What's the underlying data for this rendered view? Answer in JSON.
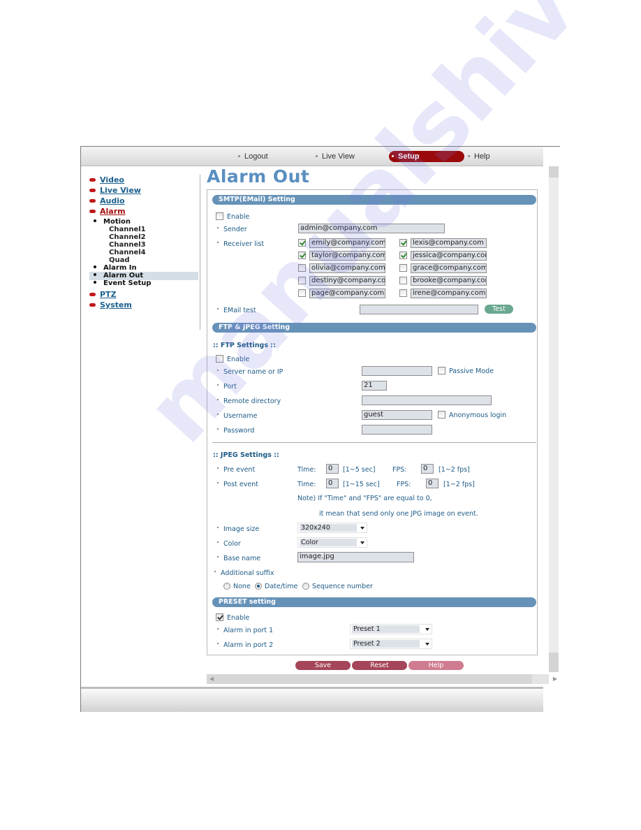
{
  "topnav": {
    "items": [
      {
        "label": "Logout",
        "active": false
      },
      {
        "label": "Live View",
        "active": false
      },
      {
        "label": "Setup",
        "active": true
      },
      {
        "label": "Help",
        "active": false
      }
    ]
  },
  "sidebar": {
    "top_items": [
      {
        "label": "Video",
        "active": false
      },
      {
        "label": "Live View",
        "active": false
      },
      {
        "label": "Audio",
        "active": false
      },
      {
        "label": "Alarm",
        "active": true
      },
      {
        "label": "PTZ",
        "active": false
      },
      {
        "label": "System",
        "active": false
      }
    ],
    "alarm_sub": [
      {
        "label": "Motion",
        "active": false
      },
      {
        "label": "Alarm In",
        "active": false
      },
      {
        "label": "Alarm Out",
        "active": true
      },
      {
        "label": "Event Setup",
        "active": false
      }
    ],
    "motion_sub": [
      "Channel1",
      "Channel2",
      "Channel3",
      "Channel4",
      "Quad"
    ]
  },
  "page": {
    "title": "Alarm Out"
  },
  "smtp": {
    "header": "SMTP(EMail) Setting",
    "enable_label": "Enable",
    "enable_checked": false,
    "sender_label": "Sender",
    "sender_value": "admin@company.com",
    "receiver_label": "Receiver list",
    "receivers": [
      {
        "email": "emily@company.com",
        "checked": true
      },
      {
        "email": "lexis@company.com",
        "checked": true
      },
      {
        "email": "taylor@company.com",
        "checked": true
      },
      {
        "email": "jessica@company.com",
        "checked": true
      },
      {
        "email": "olivia@company.com",
        "checked": false
      },
      {
        "email": "grace@company.com",
        "checked": false
      },
      {
        "email": "destiny@company.com",
        "checked": false
      },
      {
        "email": "brooke@company.com",
        "checked": false
      },
      {
        "email": "page@company.com",
        "checked": false
      },
      {
        "email": "irene@company.com",
        "checked": false
      }
    ],
    "email_test_label": "EMail test",
    "email_test_value": "",
    "test_button": "Test"
  },
  "ftp_jpeg": {
    "header": "FTP & JPEG Setting",
    "ftp_subheader": ":: FTP Settings ::",
    "enable_label": "Enable",
    "enable_checked": false,
    "server_label": "Server name or IP",
    "server_value": "",
    "passive_label": "Passive Mode",
    "passive_checked": false,
    "port_label": "Port",
    "port_value": "21",
    "remote_dir_label": "Remote directory",
    "remote_dir_value": "",
    "username_label": "Username",
    "username_value": "guest",
    "anonymous_label": "Anonymous login",
    "anonymous_checked": false,
    "password_label": "Password",
    "password_value": "",
    "jpeg_subheader": ":: JPEG Settings ::",
    "pre_event_label": "Pre event",
    "post_event_label": "Post event",
    "time_label": "Time:",
    "fps_label": "FPS:",
    "pre_time_value": "0",
    "pre_time_range": "[1~5 sec]",
    "pre_fps_value": "0",
    "pre_fps_range": "[1~2 fps]",
    "post_time_value": "0",
    "post_time_range": "[1~15 sec]",
    "post_fps_value": "0",
    "post_fps_range": "[1~2 fps]",
    "note_line1": "Note) If \"Time\" and \"FPS\" are equal to 0,",
    "note_line2": "it mean that send only one JPG image on event.",
    "image_size_label": "Image size",
    "image_size_value": "320x240",
    "color_label": "Color",
    "color_value": "Color",
    "base_name_label": "Base name",
    "base_name_value": "image.jpg",
    "suffix_label": "Additional suffix",
    "suffix_options": [
      {
        "label": "None",
        "selected": false
      },
      {
        "label": "Date/time",
        "selected": true
      },
      {
        "label": "Sequence number",
        "selected": false
      }
    ]
  },
  "preset": {
    "header": "PRESET setting",
    "enable_label": "Enable",
    "enable_checked": true,
    "port1_label": "Alarm in port 1",
    "port1_value": "Preset 1",
    "port2_label": "Alarm in port 2",
    "port2_value": "Preset 2"
  },
  "actions": {
    "save": "Save",
    "reset": "Reset",
    "help": "Help"
  },
  "watermark": "manualshive.com"
}
